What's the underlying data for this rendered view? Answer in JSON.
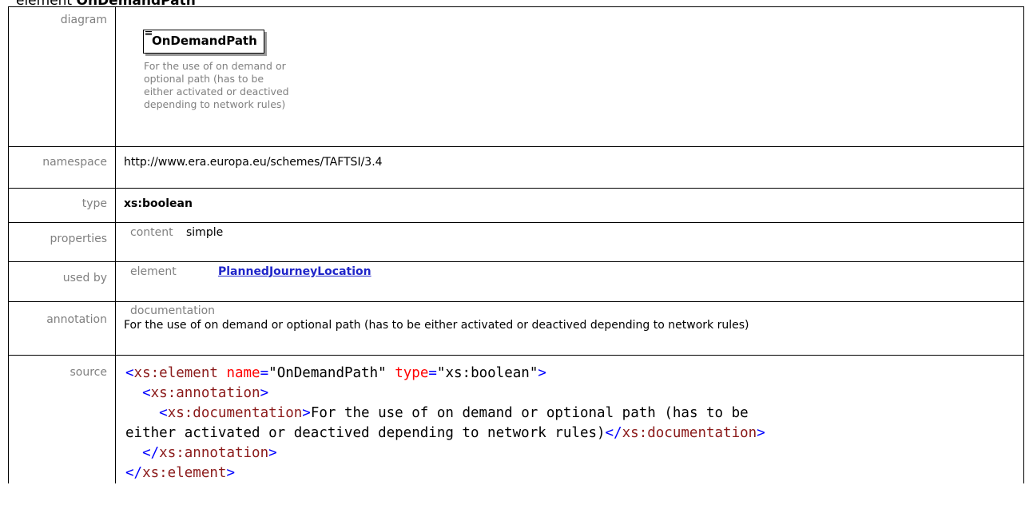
{
  "heading": {
    "prefix": "element ",
    "name": "OnDemandPath"
  },
  "rows": {
    "diagram": {
      "label": "diagram",
      "box_title": "OnDemandPath",
      "doc_lines": [
        "For the use of on demand or",
        "optional path (has to be",
        "either activated or deactived",
        "depending to network rules)"
      ]
    },
    "namespace": {
      "label": "namespace",
      "value": "http://www.era.europa.eu/schemes/TAFTSI/3.4"
    },
    "type": {
      "label": "type",
      "value": "xs:boolean"
    },
    "properties": {
      "label": "properties",
      "key": "content",
      "value": "simple"
    },
    "used_by": {
      "label": "used by",
      "key": "element",
      "value": "PlannedJourneyLocation"
    },
    "annotation": {
      "label": "annotation",
      "key": "documentation",
      "value": "For the use of on demand or optional path (has to be either activated or deactived depending to network rules)"
    },
    "source": {
      "label": "source",
      "elem_open": "xs:element",
      "attr_name": "name",
      "attr_name_val": "\"OnDemandPath\"",
      "attr_type": "type",
      "attr_type_val": "\"xs:boolean\"",
      "annotation_tag": "xs:annotation",
      "documentation_tag": "xs:documentation",
      "doc_line1": "For the use of on demand or optional path (has to be",
      "doc_line2": "either activated or deactived depending to network rules)"
    }
  },
  "colors": {
    "tag": "#8b1a1a",
    "punct": "#0000ff",
    "attr": "#ff0000",
    "link": "#1f25c9",
    "label": "#808080"
  }
}
